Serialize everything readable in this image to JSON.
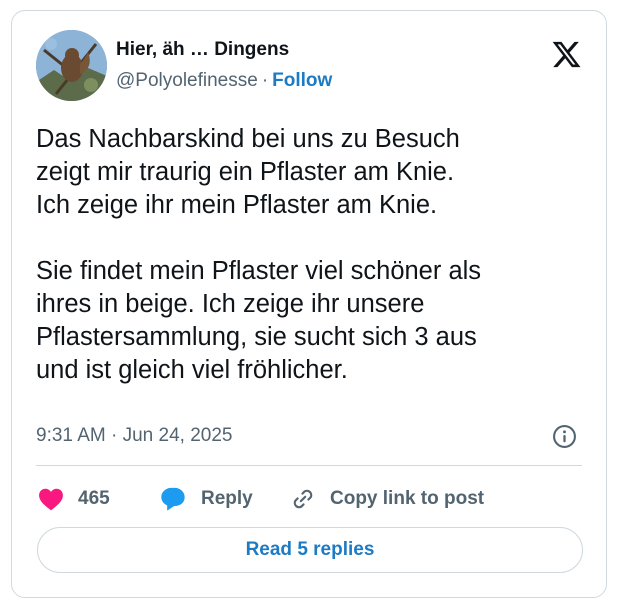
{
  "author": {
    "display_name": "Hier, äh … Dingens",
    "handle": "@Polyolefinesse",
    "separator": "·",
    "follow_label": "Follow",
    "avatar_icon": "squirrel-in-tree-avatar"
  },
  "tweet": {
    "lines": [
      "Das Nachbarskind bei uns zu Besuch",
      "zeigt mir traurig ein Pflaster am Knie.",
      "Ich zeige ihr mein Pflaster am Knie.",
      "",
      "Sie findet mein Pflaster viel schöner als",
      "ihres in beige. Ich zeige ihr unsere",
      "Pflastersammlung, sie sucht sich 3 aus",
      "und ist gleich viel fröhlicher."
    ],
    "time": "9:31 AM",
    "date_separator": "·",
    "date": "Jun 24, 2025"
  },
  "actions": {
    "like_count": "465",
    "reply_label": "Reply",
    "copy_link_label": "Copy link to post"
  },
  "read_replies_label": "Read 5 replies",
  "colors": {
    "heart": "#f91880",
    "reply_bubble": "#1d9bf0",
    "link_blue": "#1d7bc4",
    "muted": "#536471",
    "border": "#cfd9de"
  }
}
